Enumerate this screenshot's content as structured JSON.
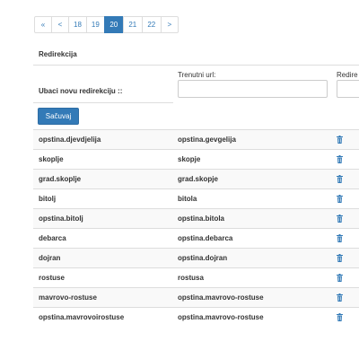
{
  "pagination": {
    "first": "«",
    "prev": "<",
    "pages": [
      "18",
      "19",
      "20",
      "21",
      "22"
    ],
    "active": "20",
    "next": ">"
  },
  "panel": {
    "title": "Redirekcija"
  },
  "form": {
    "label": "Ubaci novu redirekciju ::",
    "current_url_label": "Trenutni url:",
    "current_url_value": "",
    "redirect_label": "Redire",
    "redirect_value": "",
    "save_label": "Sačuvaj"
  },
  "table": {
    "rows": [
      {
        "from": "opstina.djevdjelija",
        "to": "opstina.gevgelija"
      },
      {
        "from": "skoplje",
        "to": "skopje"
      },
      {
        "from": "grad.skoplje",
        "to": "grad.skopje"
      },
      {
        "from": "bitolj",
        "to": "bitola"
      },
      {
        "from": "opstina.bitolj",
        "to": "opstina.bitola"
      },
      {
        "from": "debarca",
        "to": "opstina.debarca"
      },
      {
        "from": "dojran",
        "to": "opstina.dojran"
      },
      {
        "from": "rostuse",
        "to": "rostusa"
      },
      {
        "from": "mavrovo-rostuse",
        "to": "opstina.mavrovo-rostuse"
      },
      {
        "from": "opstina.mavrovoirostuse",
        "to": "opstina.mavrovo-rostuse"
      }
    ],
    "delete_icon": "trash-icon"
  },
  "colors": {
    "primary": "#337ab7",
    "border": "#dddddd",
    "stripe": "#f9f9f9"
  }
}
